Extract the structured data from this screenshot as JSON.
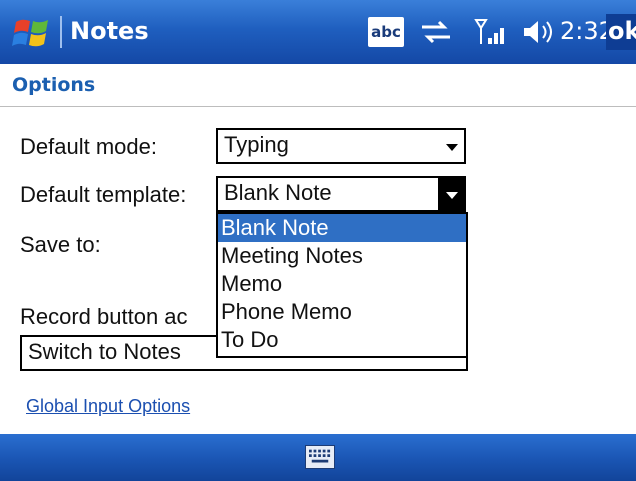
{
  "titlebar": {
    "app_title": "Notes",
    "input_indicator": "abc",
    "clock": "2:32",
    "ok_label": "ok",
    "icons": [
      "start-flag-icon",
      "sync-icon",
      "signal-icon",
      "volume-icon"
    ]
  },
  "page": {
    "title": "Options"
  },
  "form": {
    "default_mode_label": "Default mode:",
    "default_mode_value": "Typing",
    "default_template_label": "Default template:",
    "default_template_value": "Blank Note",
    "save_to_label": "Save to:",
    "record_button_label": "Record button ac",
    "record_button_value": "Switch to Notes"
  },
  "template_dropdown": {
    "options": [
      "Blank Note",
      "Meeting Notes",
      "Memo",
      "Phone Memo",
      "To Do"
    ],
    "selected_index": 0
  },
  "links": {
    "global_input_options": "Global Input Options"
  },
  "bottombar": {
    "icon": "keyboard-icon"
  },
  "colors": {
    "titlebar": "#1f5fbf",
    "selection": "#2f6fc4",
    "options_title": "#1b5fb0"
  }
}
